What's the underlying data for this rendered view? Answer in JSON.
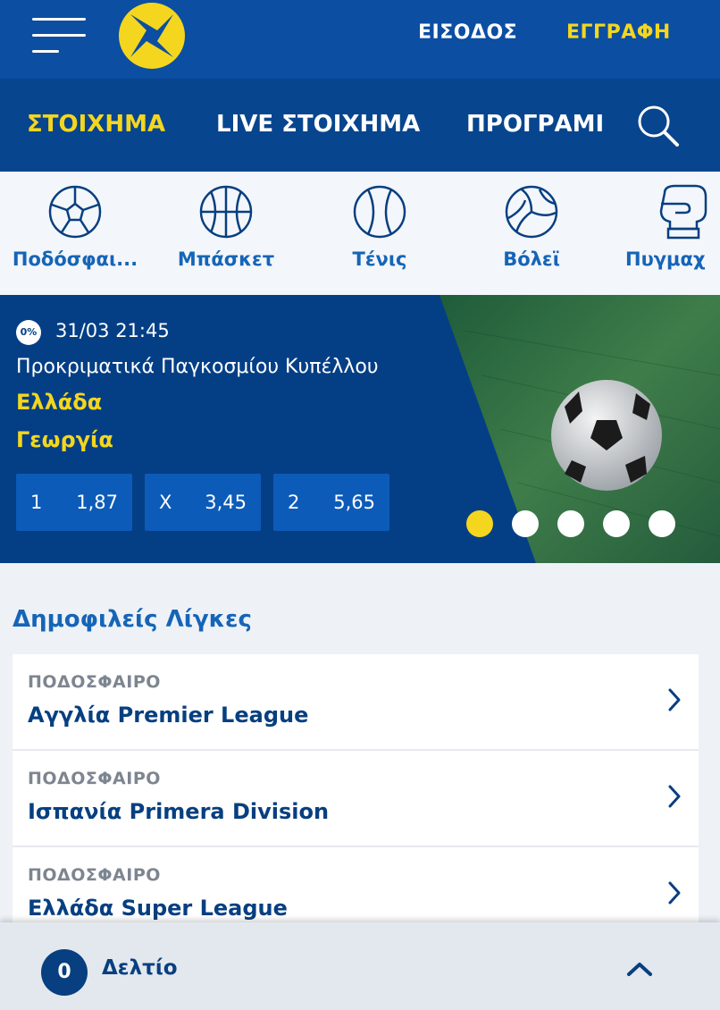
{
  "header": {
    "login_label": "ΕΙΣΟΔΟΣ",
    "register_label": "ΕΓΓΡΑΦΗ"
  },
  "nav": {
    "tabs": [
      {
        "label": "ΣΤΟΙΧΗΜΑ",
        "active": true
      },
      {
        "label": "LIVE ΣΤΟΙΧΗΜΑ",
        "active": false
      },
      {
        "label": "ΠΡΟΓΡΑΜΙ",
        "active": false
      }
    ]
  },
  "sports": [
    {
      "label": "Ποδόσφαι...",
      "icon": "football-icon"
    },
    {
      "label": "Μπάσκετ",
      "icon": "basketball-icon"
    },
    {
      "label": "Τένις",
      "icon": "tennis-ball-icon"
    },
    {
      "label": "Βόλεϊ",
      "icon": "volleyball-icon"
    },
    {
      "label": "Πυγμαχ",
      "icon": "boxing-glove-icon"
    }
  ],
  "featured": {
    "badge": "0%",
    "datetime": "31/03 21:45",
    "competition": "Προκριματικά Παγκοσμίου Κυπέλλου",
    "home": "Ελλάδα",
    "away": "Γεωργία",
    "odds": [
      {
        "key": "1",
        "value": "1,87"
      },
      {
        "key": "X",
        "value": "3,45"
      },
      {
        "key": "2",
        "value": "5,65"
      }
    ],
    "carousel_active": 1,
    "carousel_total": 5
  },
  "popular": {
    "title": "Δημοφιλείς Λίγκες",
    "leagues": [
      {
        "category": "ΠΟΔΟΣΦΑΙΡΟ",
        "name": "Αγγλία Premier League"
      },
      {
        "category": "ΠΟΔΟΣΦΑΙΡΟ",
        "name": "Ισπανία Primera Division"
      },
      {
        "category": "ΠΟΔΟΣΦΑΙΡΟ",
        "name": "Ελλάδα Super League"
      }
    ]
  },
  "betslip": {
    "count": "0",
    "label": "Δελτίο"
  },
  "colors": {
    "header_blue": "#0b4ea2",
    "nav_blue": "#07458e",
    "accent_yellow": "#f4d61f",
    "link_blue": "#1565b7",
    "dark_blue": "#073f80"
  }
}
